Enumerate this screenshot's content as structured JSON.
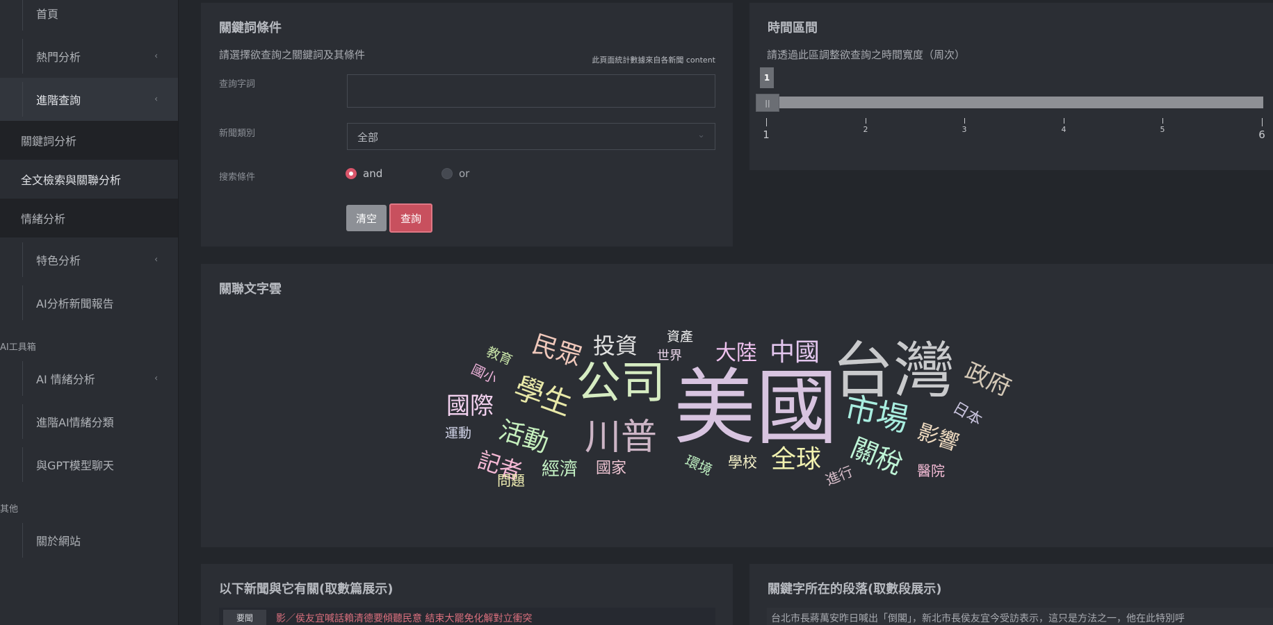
{
  "sidebar": {
    "items": [
      {
        "label": "首頁",
        "chevron": ""
      },
      {
        "label": "熱門分析",
        "chevron": "‹"
      },
      {
        "label": "進階查詢",
        "chevron": "‹"
      }
    ],
    "subitems": [
      {
        "label": "關鍵詞分析"
      },
      {
        "label": "全文檢索與關聯分析"
      },
      {
        "label": "情緒分析"
      }
    ],
    "items2": [
      {
        "label": "特色分析",
        "chevron": "‹"
      },
      {
        "label": "AI分析新聞報告",
        "chevron": ""
      }
    ],
    "section_ai": "AI工具箱",
    "items3": [
      {
        "label": "AI 情緒分析",
        "chevron": "‹"
      },
      {
        "label": "進階AI情緒分類",
        "chevron": ""
      },
      {
        "label": "與GPT模型聊天",
        "chevron": ""
      }
    ],
    "section_other": "其他",
    "items4": [
      {
        "label": "關於網站",
        "chevron": ""
      }
    ]
  },
  "keyword_panel": {
    "title": "關鍵詞條件",
    "subtitle": "請選擇欲查詢之關鍵詞及其條件",
    "note": "此頁面統計數據來自各新聞 content",
    "query_label": "查詢字詞",
    "query_value": "",
    "category_label": "新聞類別",
    "category_value": "全部",
    "condition_label": "搜索條件",
    "and_label": "and",
    "or_label": "or",
    "clear_label": "清空",
    "search_label": "查詢",
    "colors": {
      "accent": "#c8505e",
      "clear": "#8d9096"
    }
  },
  "time_panel": {
    "title": "時間區間",
    "subtitle": "請透過此區調整欲查詢之時間寬度（周次）",
    "slider_value": "1",
    "handle_glyph": "||",
    "slider_min": 1,
    "slider_max": 6,
    "ticks": [
      "1",
      "2",
      "3",
      "4",
      "5",
      "6"
    ]
  },
  "cloud_panel": {
    "title": "關聯文字雲",
    "words": [
      {
        "text": "美國",
        "color": "#d8c4e0"
      },
      {
        "text": "台灣",
        "color": "#c9cacc"
      },
      {
        "text": "公司",
        "color": "#d6ecc2"
      },
      {
        "text": "川普",
        "color": "#cdb5c6"
      },
      {
        "text": "市場",
        "color": "#a9eee0"
      },
      {
        "text": "中國",
        "color": "#e3c6ee"
      },
      {
        "text": "大陸",
        "color": "#f0c2f0"
      },
      {
        "text": "投資",
        "color": "#e2e2e2"
      },
      {
        "text": "民眾",
        "color": "#f0c8bb"
      },
      {
        "text": "學生",
        "color": "#e8e8a8"
      },
      {
        "text": "國際",
        "color": "#f4d2f0"
      },
      {
        "text": "活動",
        "color": "#c6f0be"
      },
      {
        "text": "記者",
        "color": "#f4b8d4"
      },
      {
        "text": "經濟",
        "color": "#c6f4c6"
      },
      {
        "text": "國家",
        "color": "#eec4d2"
      },
      {
        "text": "全球",
        "color": "#f2f2b0"
      },
      {
        "text": "關稅",
        "color": "#bef4d6"
      },
      {
        "text": "影響",
        "color": "#eedac0"
      },
      {
        "text": "政府",
        "color": "#d4c8b6"
      },
      {
        "text": "日本",
        "color": "#c9c4de"
      },
      {
        "text": "醫院",
        "color": "#f4bcd6"
      },
      {
        "text": "進行",
        "color": "#d6bcc8"
      },
      {
        "text": "學校",
        "color": "#f4f0c8"
      },
      {
        "text": "環境",
        "color": "#bff0c2"
      },
      {
        "text": "問題",
        "color": "#f2f0b4"
      },
      {
        "text": "運動",
        "color": "#cfd2e6"
      },
      {
        "text": "國小",
        "color": "#f0b4dc"
      },
      {
        "text": "教育",
        "color": "#c8e4a8"
      },
      {
        "text": "資產",
        "color": "#f0f0f0"
      },
      {
        "text": "世界",
        "color": "#ecd6ec"
      }
    ]
  },
  "news_panel": {
    "title": "以下新聞與它有關(取數篇展示)",
    "badge": "要聞",
    "headline": "影／侯友宜喊話賴清德要傾聽民意 結束大罷免化解對立衝突"
  },
  "paragraph_panel": {
    "title": "關鍵字所在的段落(取數段展示)",
    "text": "台北市長蔣萬安昨日喊出「倒閣」，新北市長侯友宜今受訪表示，這只是方法之一，他在此特別呼"
  }
}
